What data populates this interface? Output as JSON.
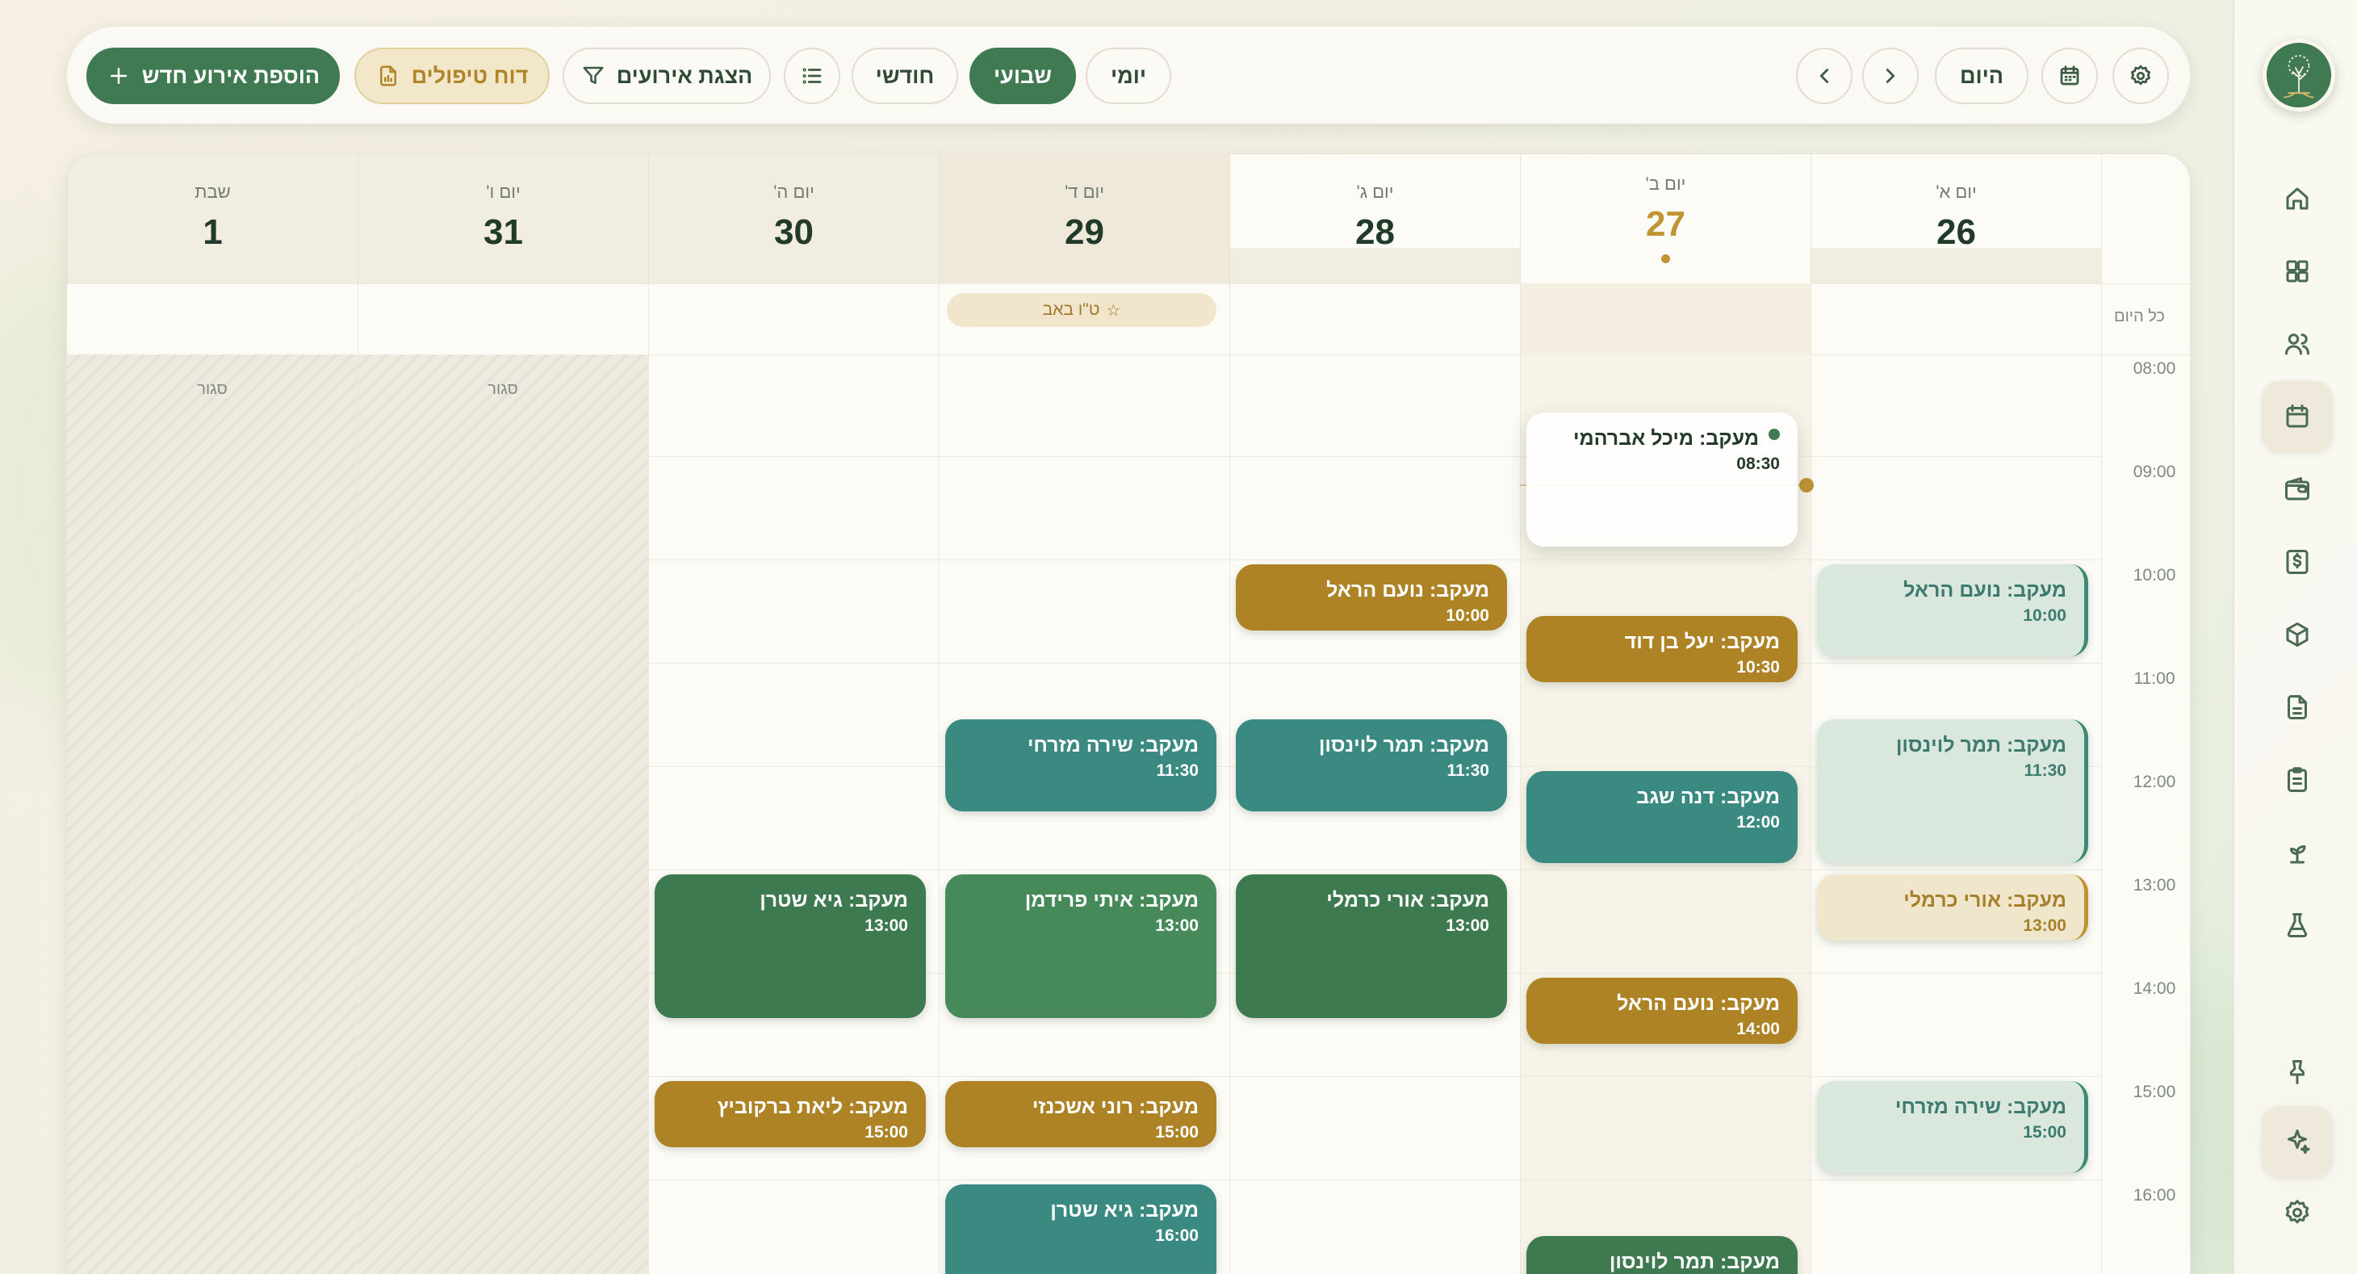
{
  "toolbar": {
    "add_event": "הוספת אירוע חדש",
    "treatments_report": "דוח טיפולים",
    "show_events": "הצגת אירועים",
    "view_monthly": "חודשי",
    "view_weekly": "שבועי",
    "view_daily": "יומי",
    "today": "היום"
  },
  "calendar": {
    "all_day_label": "כל היום",
    "closed_label": "סגור",
    "holiday": "ט\"ו באב",
    "times": [
      "08:00",
      "09:00",
      "10:00",
      "11:00",
      "12:00",
      "13:00",
      "14:00",
      "15:00",
      "16:00"
    ],
    "days": [
      {
        "name": "שבת",
        "num": "1"
      },
      {
        "name": "יום ו'",
        "num": "31"
      },
      {
        "name": "יום ה'",
        "num": "30"
      },
      {
        "name": "יום ד'",
        "num": "29"
      },
      {
        "name": "יום ג'",
        "num": "28"
      },
      {
        "name": "יום ב'",
        "num": "27"
      },
      {
        "name": "יום א'",
        "num": "26"
      }
    ],
    "events": [
      {
        "title": "מעקב: מיכל אברהמי",
        "time": "08:30"
      },
      {
        "title": "מעקב: יעל בן דוד",
        "time": "10:30"
      },
      {
        "title": "מעקב: דנה שגב",
        "time": "12:00"
      },
      {
        "title": "מעקב: נועם הראל",
        "time": "14:00"
      },
      {
        "title": "מעקב: תמר לוינסון",
        "time": ""
      },
      {
        "title": "מעקב: נועם הראל",
        "time": "10:00"
      },
      {
        "title": "מעקב: תמר לוינסון",
        "time": "11:30"
      },
      {
        "title": "מעקב: אורי כרמלי",
        "time": "13:00"
      },
      {
        "title": "מעקב: שירה מזרחי",
        "time": "15:00"
      },
      {
        "title": "מעקב: נועם הראל",
        "time": "10:00"
      },
      {
        "title": "מעקב: תמר לוינסון",
        "time": "11:30"
      },
      {
        "title": "מעקב: אורי כרמלי",
        "time": "13:00"
      },
      {
        "title": "מעקב: שירה מזרחי",
        "time": "11:30"
      },
      {
        "title": "מעקב: איתי פרידמן",
        "time": "13:00"
      },
      {
        "title": "מעקב: רוני אשכנזי",
        "time": "15:00"
      },
      {
        "title": "מעקב: גיא שטרן",
        "time": "16:00"
      },
      {
        "title": "מעקב: גיא שטרן",
        "time": "13:00"
      },
      {
        "title": "מעקב: ליאת ברקוביץ",
        "time": "15:00"
      }
    ]
  },
  "colors": {
    "brand_green": "#3f7a52",
    "gold": "#ad8326",
    "teal": "#3b8a82"
  },
  "icons": {
    "sidebar": [
      "home-icon",
      "dashboard-icon",
      "users-icon",
      "calendar-icon",
      "wallet-icon",
      "billing-icon",
      "box-icon",
      "document-icon",
      "clipboard-icon",
      "sprout-icon",
      "flask-icon",
      "pin-icon",
      "sparkle-icon",
      "settings-icon"
    ]
  }
}
